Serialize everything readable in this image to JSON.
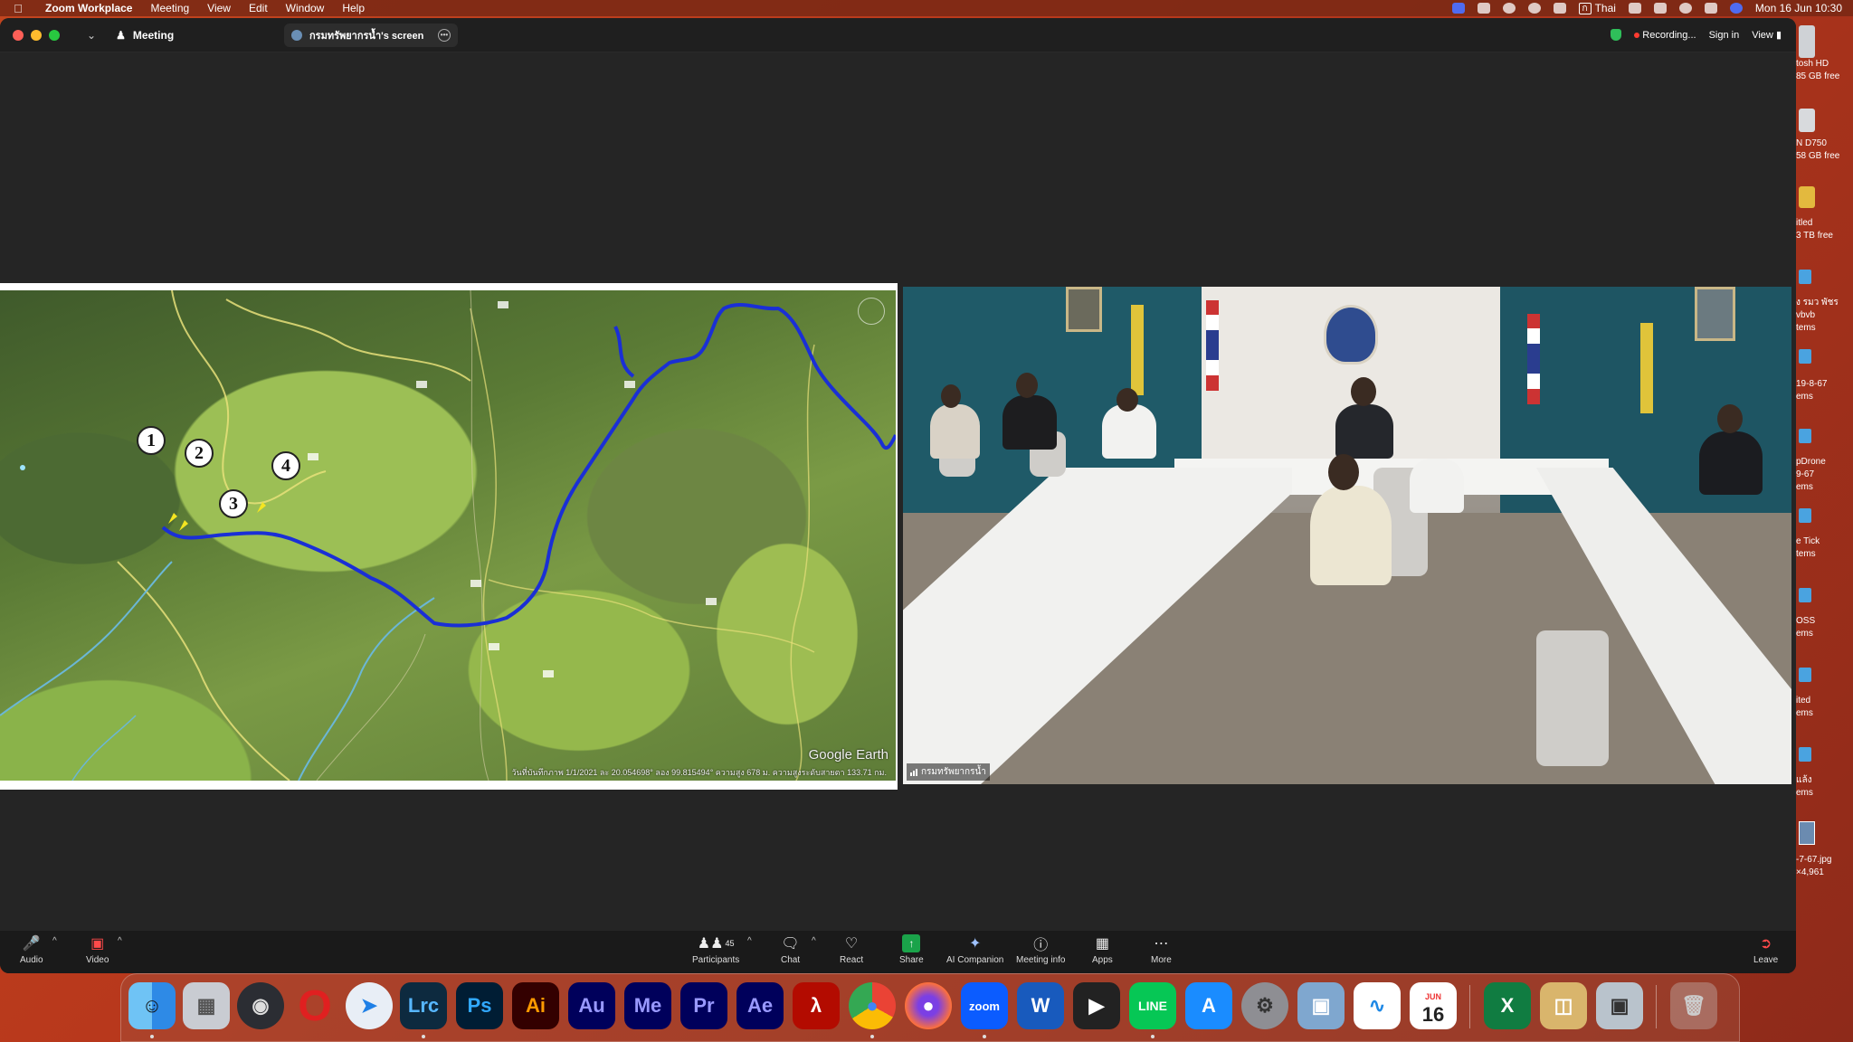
{
  "menubar": {
    "app_name": "Zoom Workplace",
    "items": [
      "Meeting",
      "View",
      "Edit",
      "Window",
      "Help"
    ],
    "input_lang": "Thai",
    "datetime": "Mon 16 Jun  10:30"
  },
  "titlebar": {
    "meeting_tab": "Meeting",
    "screen_tab": "กรมทรัพยากรน้ำ's screen",
    "recording": "Recording...",
    "sign_in": "Sign in",
    "view": "View"
  },
  "shared_screen": {
    "markers": [
      "1",
      "2",
      "3",
      "4"
    ],
    "logo_text": "Google Earth",
    "status_text": "วันที่บันทึกภาพ 1/1/2021   ละ 20.054698°  ลอง 99.815494°  ความสูง 678 ม.   ความสูงระดับสายตา 133.71 กม."
  },
  "video": {
    "participant_name": "กรมทรัพยากรน้ำ"
  },
  "toolbar": {
    "audio": "Audio",
    "video": "Video",
    "participants": "Participants",
    "participant_count": "45",
    "chat": "Chat",
    "react": "React",
    "share": "Share",
    "ai_companion": "AI Companion",
    "meeting_info": "Meeting info",
    "apps": "Apps",
    "more": "More",
    "leave": "Leave"
  },
  "desktop": {
    "labels": [
      "tosh HD",
      "85 GB free",
      "N D750",
      "58 GB free",
      "itled",
      "3 TB free",
      "ง รมว พัชร",
      "vbvb",
      "tems",
      "19-8-67",
      "ems",
      "pDrone",
      "9-67",
      "ems",
      "e Tick",
      "tems",
      "OSS",
      "ems",
      "ited",
      "ems",
      "แล้ง",
      "ems",
      "-7-67.jpg",
      "×4,961"
    ]
  },
  "dock": {
    "apps": [
      "Finder",
      "Launchpad",
      "OBS",
      "Opera",
      "Safari",
      "Lrc",
      "Ps",
      "Ai",
      "Au",
      "Me",
      "Pr",
      "Ae",
      "Acrobat",
      "Chrome",
      "Firefox",
      "zoom",
      "Word",
      "Final Cut Pro",
      "LINE",
      "App Store",
      "System Settings",
      "Preview",
      "Freeform",
      "Calendar",
      "Excel",
      "Archive",
      "Screenshot",
      "Trash"
    ],
    "calendar_month": "JUN",
    "calendar_day": "16"
  },
  "colors": {
    "river": "#1a2fd6",
    "toolbar_bg": "#1a1a1a",
    "stage_bg": "#252525",
    "share_green": "#1aa34a",
    "recording_red": "#ff3b30"
  }
}
